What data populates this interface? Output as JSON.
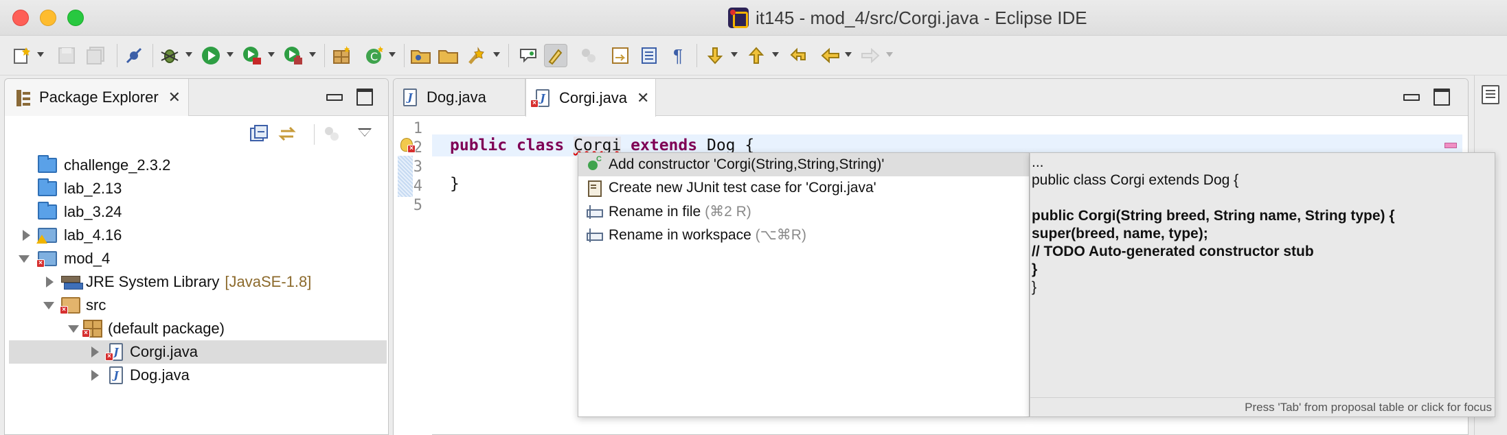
{
  "window": {
    "title": "it145 - mod_4/src/Corgi.java - Eclipse IDE"
  },
  "toolbar": {
    "icons": [
      "new-icon",
      "save-icon",
      "save-all-icon",
      "skip-breakpoints-icon",
      "debug-icon",
      "run-icon",
      "coverage-icon",
      "external-tools-icon",
      "new-java-package-icon",
      "new-java-class-icon",
      "open-type-icon",
      "open-task-icon",
      "search-icon",
      "toggle-breadcrumb-icon",
      "mark-occurrences-icon",
      "block-selection-icon",
      "show-whitespace-icon",
      "next-annotation-icon",
      "previous-annotation-icon",
      "last-edit-icon",
      "back-icon",
      "forward-icon"
    ]
  },
  "package_explorer": {
    "tab_label": "Package Explorer",
    "tree": [
      {
        "label": "challenge_2.3.2"
      },
      {
        "label": "lab_2.13"
      },
      {
        "label": "lab_3.24"
      },
      {
        "label": "lab_4.16"
      },
      {
        "label": "mod_4"
      },
      {
        "label": "JRE System Library",
        "suffix": "[JavaSE-1.8]"
      },
      {
        "label": "src"
      },
      {
        "label": "(default package)"
      },
      {
        "label": "Corgi.java"
      },
      {
        "label": "Dog.java"
      }
    ]
  },
  "editor": {
    "tabs": [
      {
        "label": "Dog.java"
      },
      {
        "label": "Corgi.java"
      }
    ],
    "line_numbers": [
      "1",
      "2",
      "3",
      "4",
      "5"
    ],
    "code": {
      "kw_public": "public",
      "kw_class": "class",
      "class_name": "Corgi",
      "kw_extends": "extends",
      "super_name": "Dog",
      "open_brace": "{",
      "close_brace": "}"
    }
  },
  "quick_fix": {
    "proposals": [
      {
        "label": "Add constructor 'Corgi(String,String,String)'",
        "shortcut": ""
      },
      {
        "label": "Create new JUnit test case for 'Corgi.java'",
        "shortcut": ""
      },
      {
        "label": "Rename in file",
        "shortcut": "(⌘2 R)"
      },
      {
        "label": "Rename in workspace",
        "shortcut": "(⌥⌘R)"
      }
    ],
    "preview_lines": [
      "...",
      "public class Corgi extends Dog {",
      "",
      "public Corgi(String breed, String name, String type) {",
      "super(breed, name, type);",
      "// TODO Auto-generated constructor stub",
      "}",
      "}"
    ],
    "status": "Press 'Tab' from proposal table or click for focus"
  },
  "colors": {
    "keyword": "#7f0055",
    "selection": "#dcdcdc",
    "current_line": "#e8f2fe"
  }
}
